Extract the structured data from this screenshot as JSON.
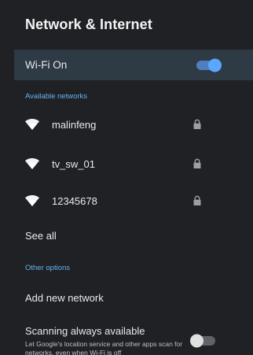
{
  "header": {
    "title": "Network & Internet"
  },
  "wifi": {
    "label": "Wi-Fi On",
    "enabled": true,
    "accent_color": "#5aa7ff"
  },
  "available_networks": {
    "header": "Available networks",
    "items": [
      {
        "name": "malinfeng",
        "icon": "wifi-icon",
        "secured": true,
        "lock_icon": "lock-icon"
      },
      {
        "name": "tv_sw_01",
        "icon": "wifi-icon",
        "secured": true,
        "lock_icon": "lock-icon"
      },
      {
        "name": "12345678",
        "icon": "wifi-icon",
        "secured": true,
        "lock_icon": "lock-icon"
      }
    ],
    "see_all_label": "See all"
  },
  "other_options": {
    "header": "Other options",
    "add_network_label": "Add new network",
    "scanning": {
      "title": "Scanning always available",
      "description": "Let Google's location service and other apps scan for networks, even when Wi-Fi is off",
      "enabled": false
    }
  }
}
